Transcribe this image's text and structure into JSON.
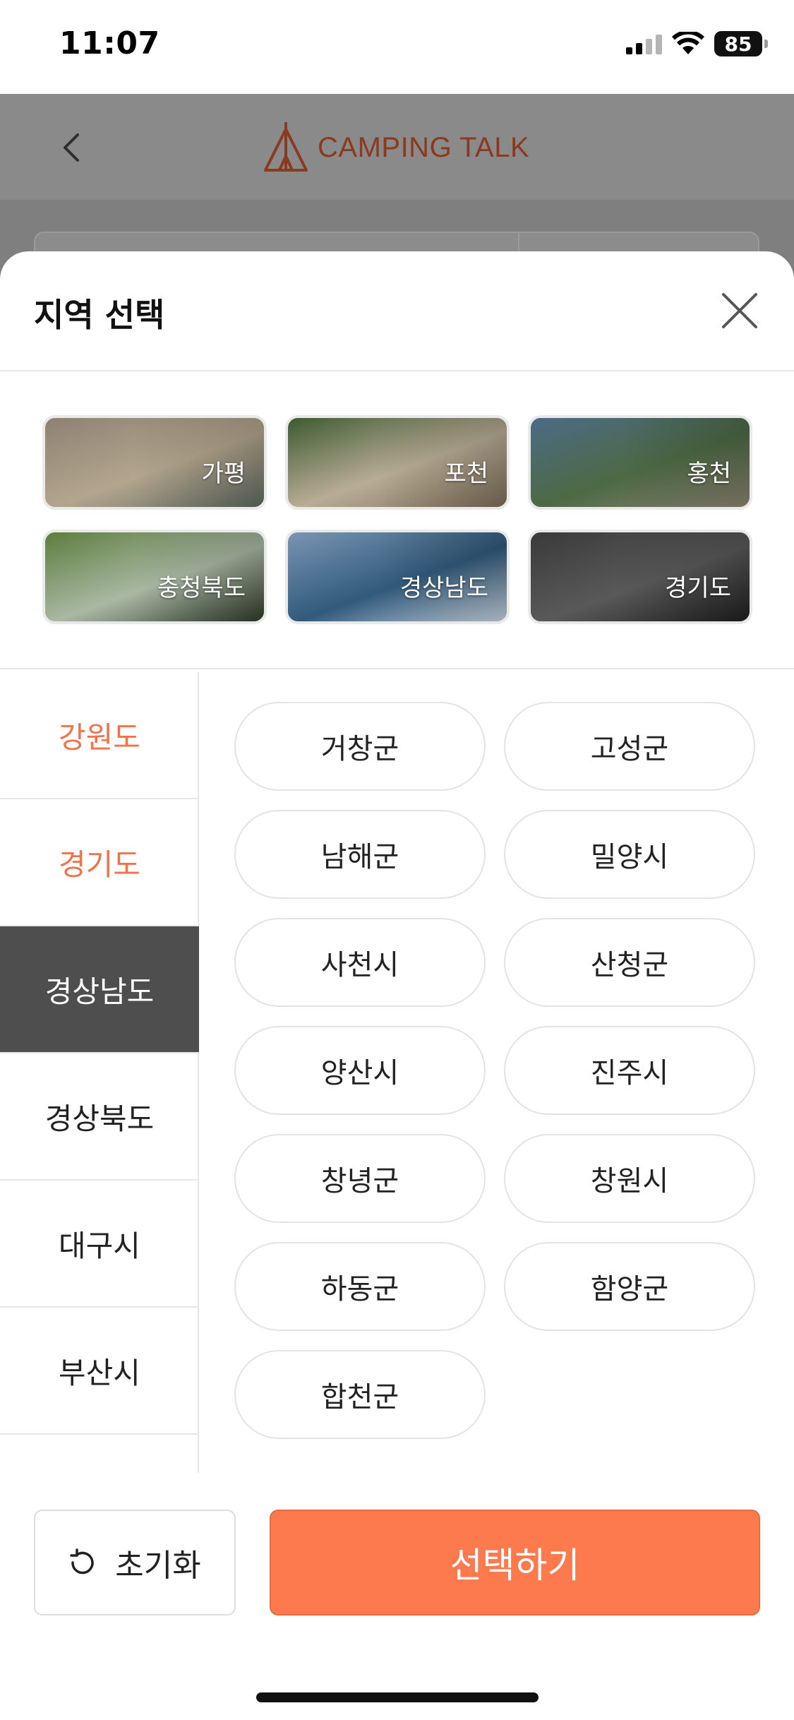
{
  "status_bar": {
    "time": "11:07",
    "battery": "85"
  },
  "app": {
    "brand": "CAMPING TALK"
  },
  "sheet": {
    "title": "지역 선택",
    "featured": [
      {
        "label": "가평",
        "palette": [
          "#8d8172",
          "#b3a58d",
          "#5e6a60"
        ]
      },
      {
        "label": "포천",
        "palette": [
          "#3d5a30",
          "#b8ac95",
          "#7c6d58"
        ]
      },
      {
        "label": "홍천",
        "palette": [
          "#4b6b86",
          "#4d6a44",
          "#8d8474"
        ]
      },
      {
        "label": "충청북도",
        "palette": [
          "#5d7d3e",
          "#a9b8a3",
          "#2f3b2a"
        ]
      },
      {
        "label": "경상남도",
        "palette": [
          "#7a95b3",
          "#315a7b",
          "#c9d6e2"
        ]
      },
      {
        "label": "경기도",
        "palette": [
          "#3a3a3a",
          "#595959",
          "#1f1f1f"
        ]
      }
    ],
    "provinces": [
      {
        "label": "강원도",
        "state": "has-sel"
      },
      {
        "label": "경기도",
        "state": "has-sel"
      },
      {
        "label": "경상남도",
        "state": "active"
      },
      {
        "label": "경상북도",
        "state": ""
      },
      {
        "label": "대구시",
        "state": ""
      },
      {
        "label": "부산시",
        "state": ""
      }
    ],
    "districts": [
      "거창군",
      "고성군",
      "남해군",
      "밀양시",
      "사천시",
      "산청군",
      "양산시",
      "진주시",
      "창녕군",
      "창원시",
      "하동군",
      "함양군",
      "합천군"
    ],
    "reset_label": "초기화",
    "submit_label": "선택하기"
  },
  "colors": {
    "accent": "#fd7a4f",
    "active_bg": "#4e4e4e",
    "selected_text": "#f4714a"
  }
}
